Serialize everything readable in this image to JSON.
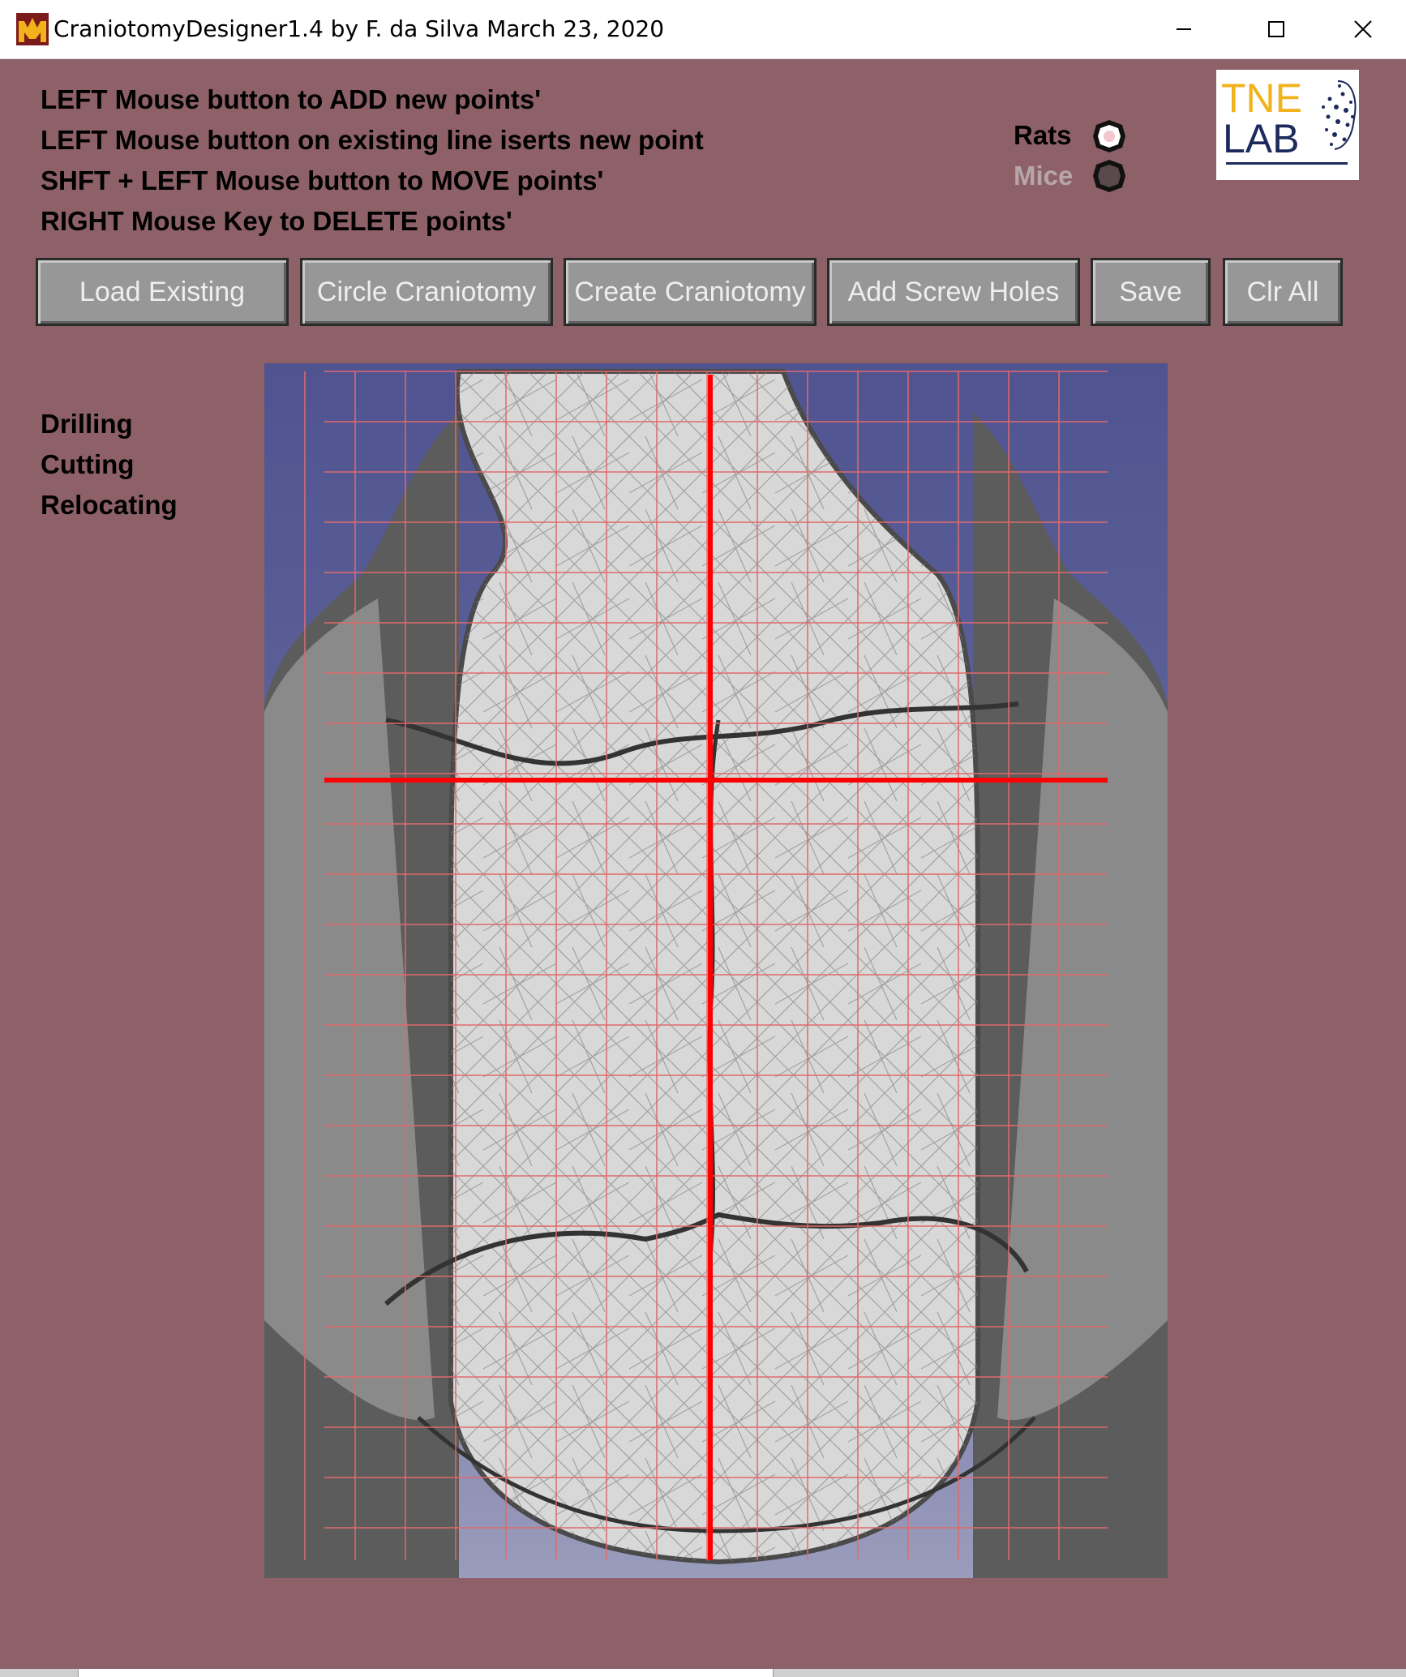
{
  "window": {
    "title": "CraniotomyDesigner1.4 by F. da Silva March 23, 2020",
    "controls": [
      "minimize-icon",
      "maximize-icon",
      "close-icon"
    ]
  },
  "instructions": [
    "LEFT Mouse button to ADD new points'",
    "LEFT Mouse button on existing line iserts new point",
    "SHFT + LEFT Mouse button to MOVE points'",
    "RIGHT Mouse Key to DELETE points'"
  ],
  "species": {
    "options": [
      "Rats",
      "Mice"
    ],
    "selected": "Rats"
  },
  "logo": {
    "line1": "TNE",
    "line2": "LAB"
  },
  "buttons": {
    "load_existing": "Load Existing",
    "circle_craniotomy": "Circle Craniotomy",
    "create_craniotomy": "Create Craniotomy",
    "add_screw_holes": "Add Screw Holes",
    "save": "Save",
    "clear_all": "Clr All"
  },
  "status": [
    "Drilling",
    "Cutting",
    "Relocating"
  ],
  "colors": {
    "background": "#8e6169",
    "button_face": "#979797",
    "button_text": "#eeeeee",
    "grid_line": "#e06a6a",
    "crosshair": "#ff0000",
    "viewport_bg": "#5a5e96",
    "skull": "#dcdcdc",
    "logo_gold": "#f2b21c",
    "logo_navy": "#1d2a5c"
  }
}
